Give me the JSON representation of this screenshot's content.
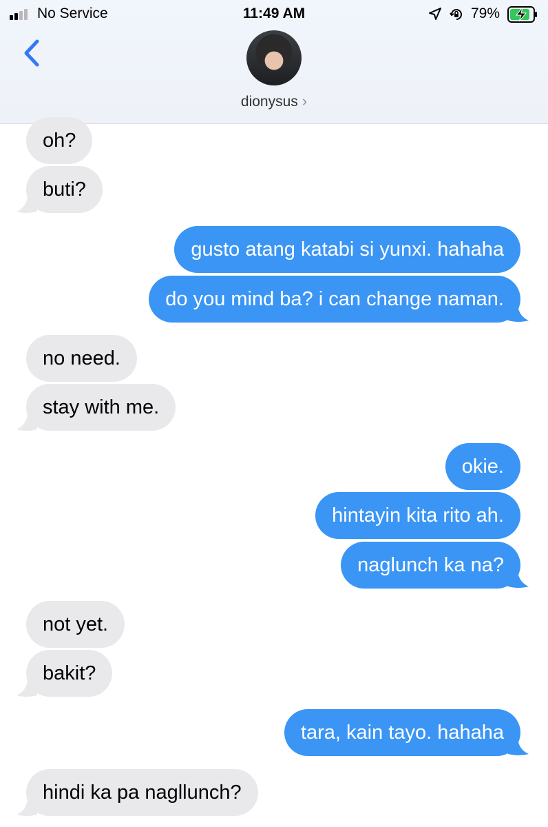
{
  "status": {
    "carrier": "No Service",
    "time": "11:49 AM",
    "battery": "79%"
  },
  "header": {
    "contact_name": "dionysus",
    "chevron": "›"
  },
  "colors": {
    "sent_bubble": "#3a95f5",
    "received_bubble": "#e9e9eb",
    "accent": "#3478f6"
  },
  "messages": [
    {
      "from": "them",
      "text": "oh?"
    },
    {
      "from": "them",
      "text": "buti?"
    },
    {
      "from": "me",
      "text": "gusto atang katabi si yunxi. hahaha"
    },
    {
      "from": "me",
      "text": "do you mind ba? i can change naman."
    },
    {
      "from": "them",
      "text": "no need."
    },
    {
      "from": "them",
      "text": "stay with me."
    },
    {
      "from": "me",
      "text": "okie."
    },
    {
      "from": "me",
      "text": "hintayin kita rito ah."
    },
    {
      "from": "me",
      "text": "naglunch ka na?"
    },
    {
      "from": "them",
      "text": "not yet."
    },
    {
      "from": "them",
      "text": "bakit?"
    },
    {
      "from": "me",
      "text": "tara, kain tayo. hahaha"
    },
    {
      "from": "them",
      "text": "hindi ka pa nagllunch?"
    }
  ]
}
